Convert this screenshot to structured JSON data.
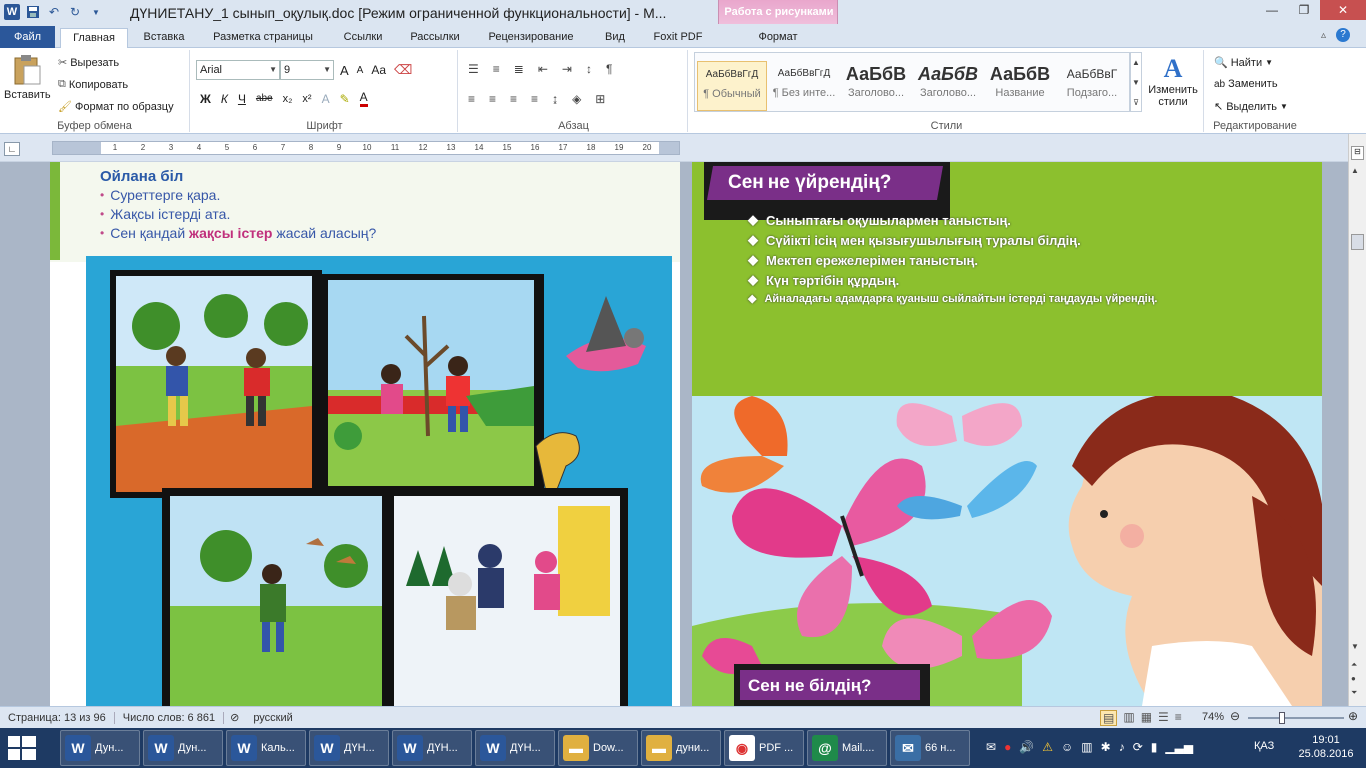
{
  "window": {
    "title": "ДҮНИЕТАНУ_1 сынып_оқулық.doc [Режим ограниченной функциональности]  -  M...",
    "context_tab_group": "Работа с рисунками"
  },
  "tabs": [
    "Файл",
    "Главная",
    "Вставка",
    "Разметка страницы",
    "Ссылки",
    "Рассылки",
    "Рецензирование",
    "Вид",
    "Foxit PDF",
    "Формат"
  ],
  "clipboard": {
    "paste": "Вставить",
    "cut": "Вырезать",
    "copy": "Копировать",
    "format_painter": "Формат по образцу",
    "label": "Буфер обмена"
  },
  "font": {
    "name": "Arial",
    "size": "9",
    "label": "Шрифт",
    "bold": "Ж",
    "italic": "К",
    "underline": "Ч",
    "strike": "abe",
    "sub": "x₂",
    "sup": "x²",
    "grow": "A",
    "shrink": "A",
    "case": "Aa",
    "color_letter": "A"
  },
  "paragraph": {
    "label": "Абзац"
  },
  "styles": {
    "label": "Стили",
    "items": [
      {
        "sample": "АаБбВвГгД",
        "name": "¶ Обычный"
      },
      {
        "sample": "АаБбВвГгД",
        "name": "¶ Без инте..."
      },
      {
        "sample": "АаБбВ",
        "name": "Заголово..."
      },
      {
        "sample": "АаБбВ",
        "name": "Заголово..."
      },
      {
        "sample": "АаБбВ",
        "name": "Название"
      },
      {
        "sample": "АаБбВвГ",
        "name": "Подзаго..."
      }
    ],
    "change": "Изменить стили"
  },
  "editing": {
    "label": "Редактирование",
    "find": "Найти",
    "replace": "Заменить",
    "select": "Выделить"
  },
  "ruler": {
    "ticks": [
      "1",
      "2",
      "3",
      "4",
      "5",
      "6",
      "7",
      "8",
      "9",
      "10",
      "11",
      "12",
      "13",
      "14",
      "15",
      "16",
      "17",
      "18",
      "19",
      "20"
    ]
  },
  "page_left": {
    "heading": "Ойлана біл",
    "bullets": [
      "Суреттерге қара.",
      "Жақсы істерді ата."
    ],
    "bullet3_prefix": "Сен қандай ",
    "bullet3_bold": "жақсы істер",
    "bullet3_suffix": " жасай аласың?"
  },
  "page_right": {
    "banner_word": "Сен",
    "banner_rest": "не үйрендің?",
    "bullets": [
      "Сыныптағы оқушылармен таныстың.",
      "Сүйікті ісің мен қызығушылығың туралы білдің.",
      "Мектеп ережелерімен таныстың.",
      "Күн тәртібін құрдың.",
      "Айналадағы адамдарға қуаныш сыйлайтын істерді таңдауды үйрендің."
    ],
    "bottom_banner": "Сен не білдің?"
  },
  "status": {
    "page": "Страница: 13 из 96",
    "words": "Число слов: 6 861",
    "lang": "русский",
    "zoom": "74%",
    "zoom_level": 0.74
  },
  "taskbar": {
    "buttons": [
      "Дун...",
      "Дун...",
      "Каль...",
      "ДҮН...",
      "ДҮН...",
      "ДҮН...",
      "Dow...",
      "дуни...",
      "PDF ...",
      "Mail....",
      "66 н..."
    ],
    "lang": "ҚАЗ",
    "time": "19:01",
    "date": "25.08.2016"
  }
}
